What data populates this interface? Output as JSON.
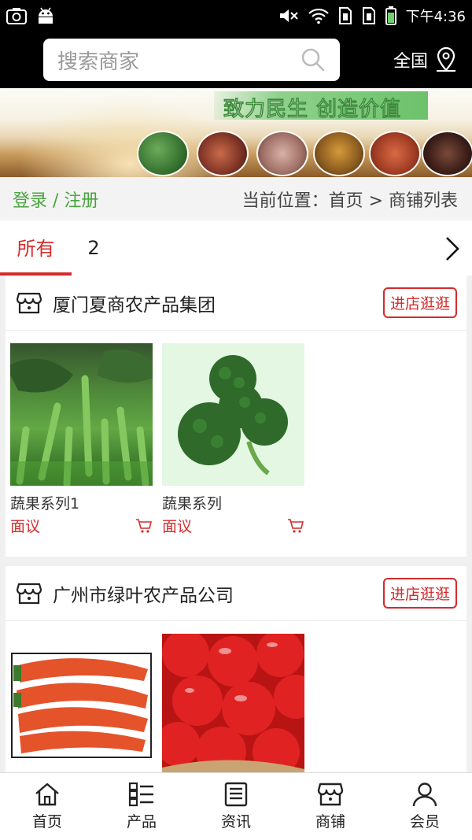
{
  "status_bar": {
    "time": "下午4:36"
  },
  "header": {
    "search_placeholder": "搜索商家",
    "region": "全国"
  },
  "banner": {
    "slogan": "致力民生 创造价值"
  },
  "breadcrumb": {
    "login": "登录 / 注册",
    "path": "当前位置：首页 > 商铺列表"
  },
  "tabs": [
    {
      "label": "所有",
      "active": true
    },
    {
      "label": "2",
      "active": false
    }
  ],
  "shops": [
    {
      "name": "厦门夏商农产品集团",
      "button": "进店逛逛",
      "products": [
        {
          "name": "蔬果系列1",
          "price": "面议"
        },
        {
          "name": "蔬果系列",
          "price": "面议"
        }
      ]
    },
    {
      "name": "广州市绿叶农产品公司",
      "button": "进店逛逛",
      "products": [
        {
          "name": "",
          "price": ""
        },
        {
          "name": "",
          "price": ""
        }
      ]
    }
  ],
  "bottom_nav": [
    {
      "label": "首页",
      "icon": "home-icon"
    },
    {
      "label": "产品",
      "icon": "list-icon"
    },
    {
      "label": "资讯",
      "icon": "news-icon"
    },
    {
      "label": "商铺",
      "icon": "store-icon"
    },
    {
      "label": "会员",
      "icon": "user-icon"
    }
  ],
  "colors": {
    "accent": "#d62b2b",
    "login_green": "#4aa53f",
    "header_bg": "#000000"
  }
}
